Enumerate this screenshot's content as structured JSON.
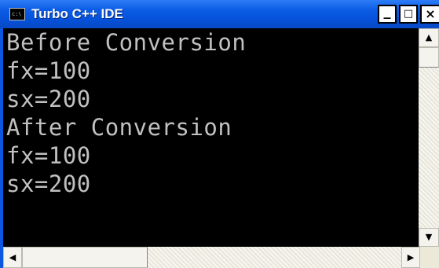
{
  "window": {
    "title": "Turbo C++ IDE",
    "icon_name": "console-icon",
    "icon_glyph": "c:\\",
    "controls": {
      "minimize_glyph": "_",
      "maximize_glyph": "□",
      "close_glyph": "×"
    }
  },
  "console": {
    "lines": [
      "Before Conversion",
      "fx=100",
      "sx=200",
      "After Conversion",
      "fx=100",
      "sx=200"
    ]
  },
  "scrollbars": {
    "up_glyph": "▲",
    "down_glyph": "▼",
    "left_glyph": "◀",
    "right_glyph": "▶"
  },
  "colors": {
    "titlebar": "#0b5ce6",
    "console_background": "#000000",
    "console_text": "#c0c0c0",
    "scrollbar": "#ece9d8"
  }
}
